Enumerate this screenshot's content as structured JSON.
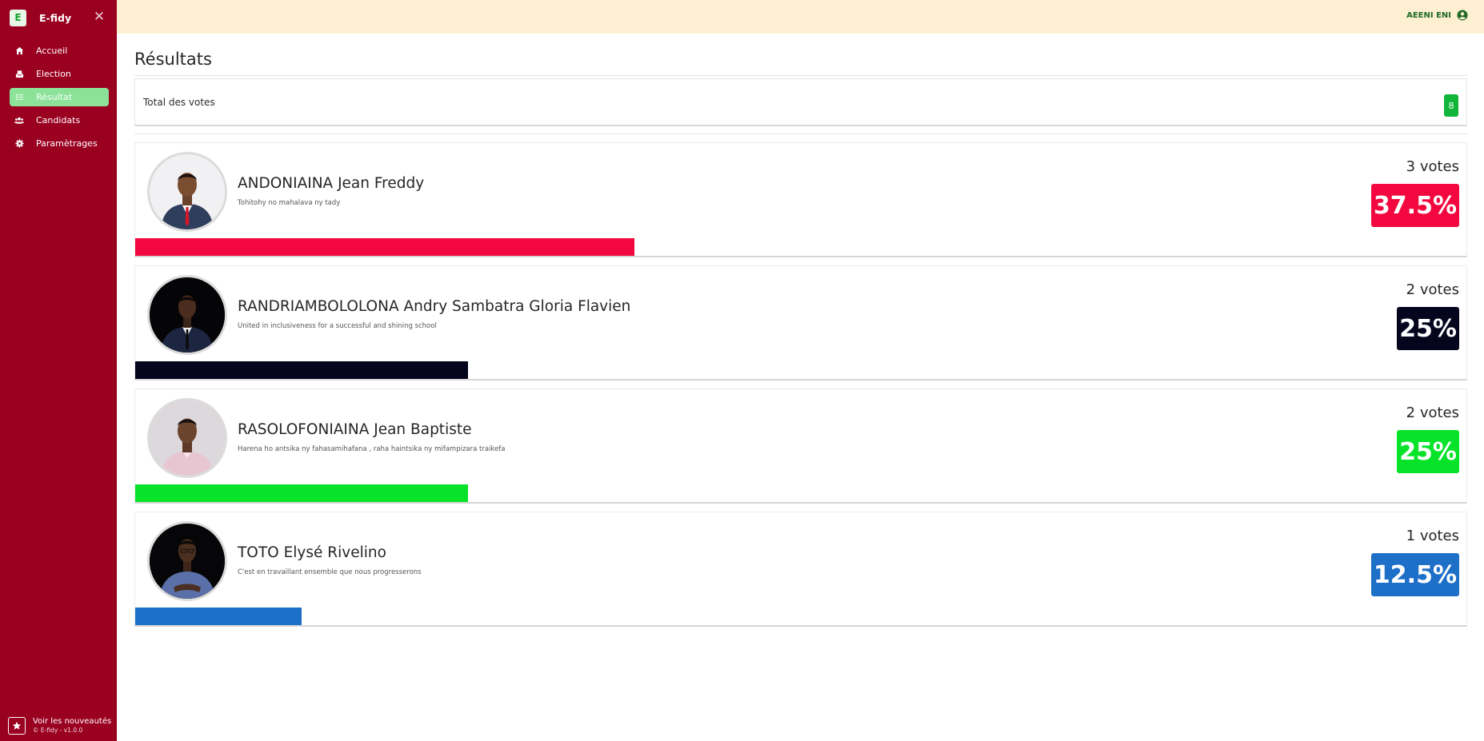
{
  "app": {
    "logo_letter": "E",
    "name": "E-fidy"
  },
  "sidebar": {
    "items": [
      {
        "label": "Accueil",
        "icon": "home-icon"
      },
      {
        "label": "Election",
        "icon": "ballot-icon"
      },
      {
        "label": "Résultat",
        "icon": "list-icon",
        "active": true
      },
      {
        "label": "Candidats",
        "icon": "users-icon"
      },
      {
        "label": "Paramètrages",
        "icon": "gear-icon"
      }
    ],
    "footer": {
      "link": "Voir les nouveautés",
      "version": "© E-fidy - v1.0.0"
    }
  },
  "topbar": {
    "user": "AEENI ENI"
  },
  "page": {
    "title": "Résultats",
    "total_label": "Total des votes",
    "total_value": "8"
  },
  "candidates": [
    {
      "name": "ANDONIAINA Jean Freddy",
      "slogan": "Tohitohy no mahalava ny tady",
      "votes": "3 votes",
      "percent_label": "37.5%",
      "percent": 37.5,
      "color": "#f2083e"
    },
    {
      "name": "RANDRIAMBOLOLONA Andry Sambatra Gloria Flavien",
      "slogan": "United in inclusiveness for a successful and shining school",
      "votes": "2 votes",
      "percent_label": "25%",
      "percent": 25,
      "color": "#05051e"
    },
    {
      "name": "RASOLOFONIAINA Jean Baptiste",
      "slogan": "Harena ho antsika ny fahasamihafana , raha haintsika ny mifampizara traikefa",
      "votes": "2 votes",
      "percent_label": "25%",
      "percent": 25,
      "color": "#06e328"
    },
    {
      "name": "TOTO Elysé Rivelino",
      "slogan": "C'est en travaillant ensemble que nous progresserons",
      "votes": "1 votes",
      "percent_label": "12.5%",
      "percent": 12.5,
      "color": "#1e6fc8"
    }
  ],
  "colors": {
    "sidebar_bg": "#9a0020",
    "topbar_bg": "#fdf0d2",
    "active_nav": "#8de29a",
    "total_badge": "#10b53a"
  }
}
